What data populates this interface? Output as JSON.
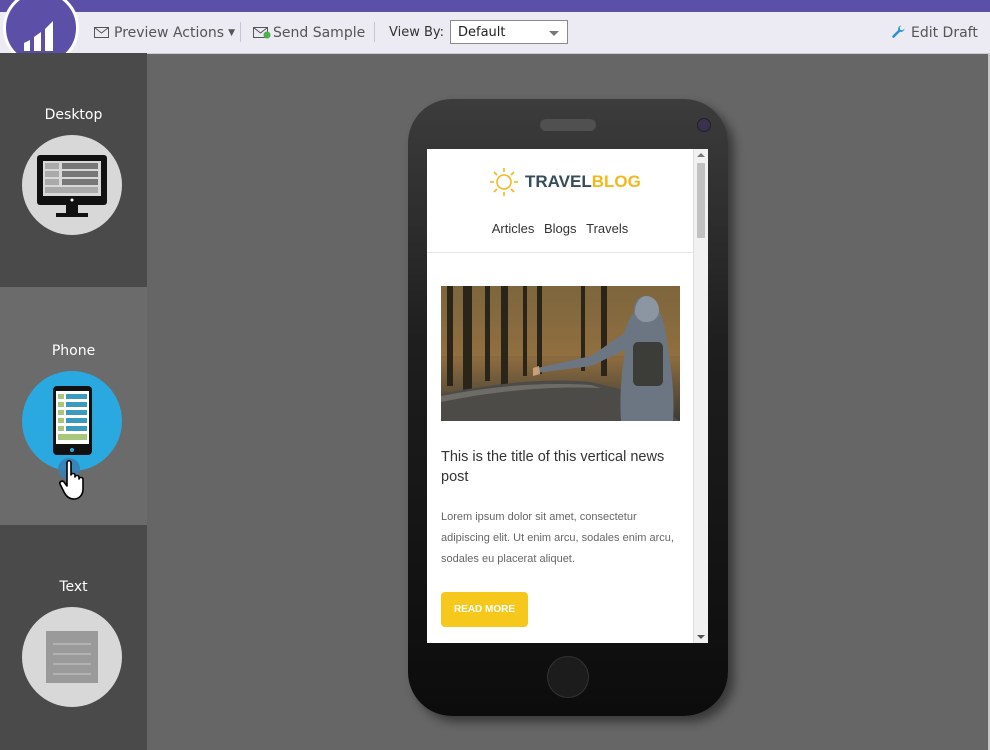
{
  "toolbar": {
    "preview_actions_label": "Preview Actions",
    "send_sample_label": "Send Sample",
    "view_by_label": "View By:",
    "view_by_value": "Default",
    "edit_draft_label": "Edit Draft"
  },
  "views": [
    {
      "label": "Desktop",
      "icon": "desktop-icon"
    },
    {
      "label": "Phone",
      "icon": "phone-icon",
      "active": true
    },
    {
      "label": "Text",
      "icon": "text-doc-icon"
    }
  ],
  "email": {
    "logo_part1": "TRAVEL",
    "logo_part2": "BLOG",
    "nav": [
      "Articles",
      "Blogs",
      "Travels"
    ],
    "post_title": "This is the title of this vertical news post",
    "post_body": "Lorem ipsum dolor sit amet, consectetur adipiscing elit. Ut enim arcu, sodales enim arcu, sodales eu placerat aliquet.",
    "button_label": "READ MORE"
  },
  "colors": {
    "brand_purple": "#5c4fa8",
    "phone_view_circle": "#2aa9e0",
    "read_more_button": "#f6c81b"
  }
}
